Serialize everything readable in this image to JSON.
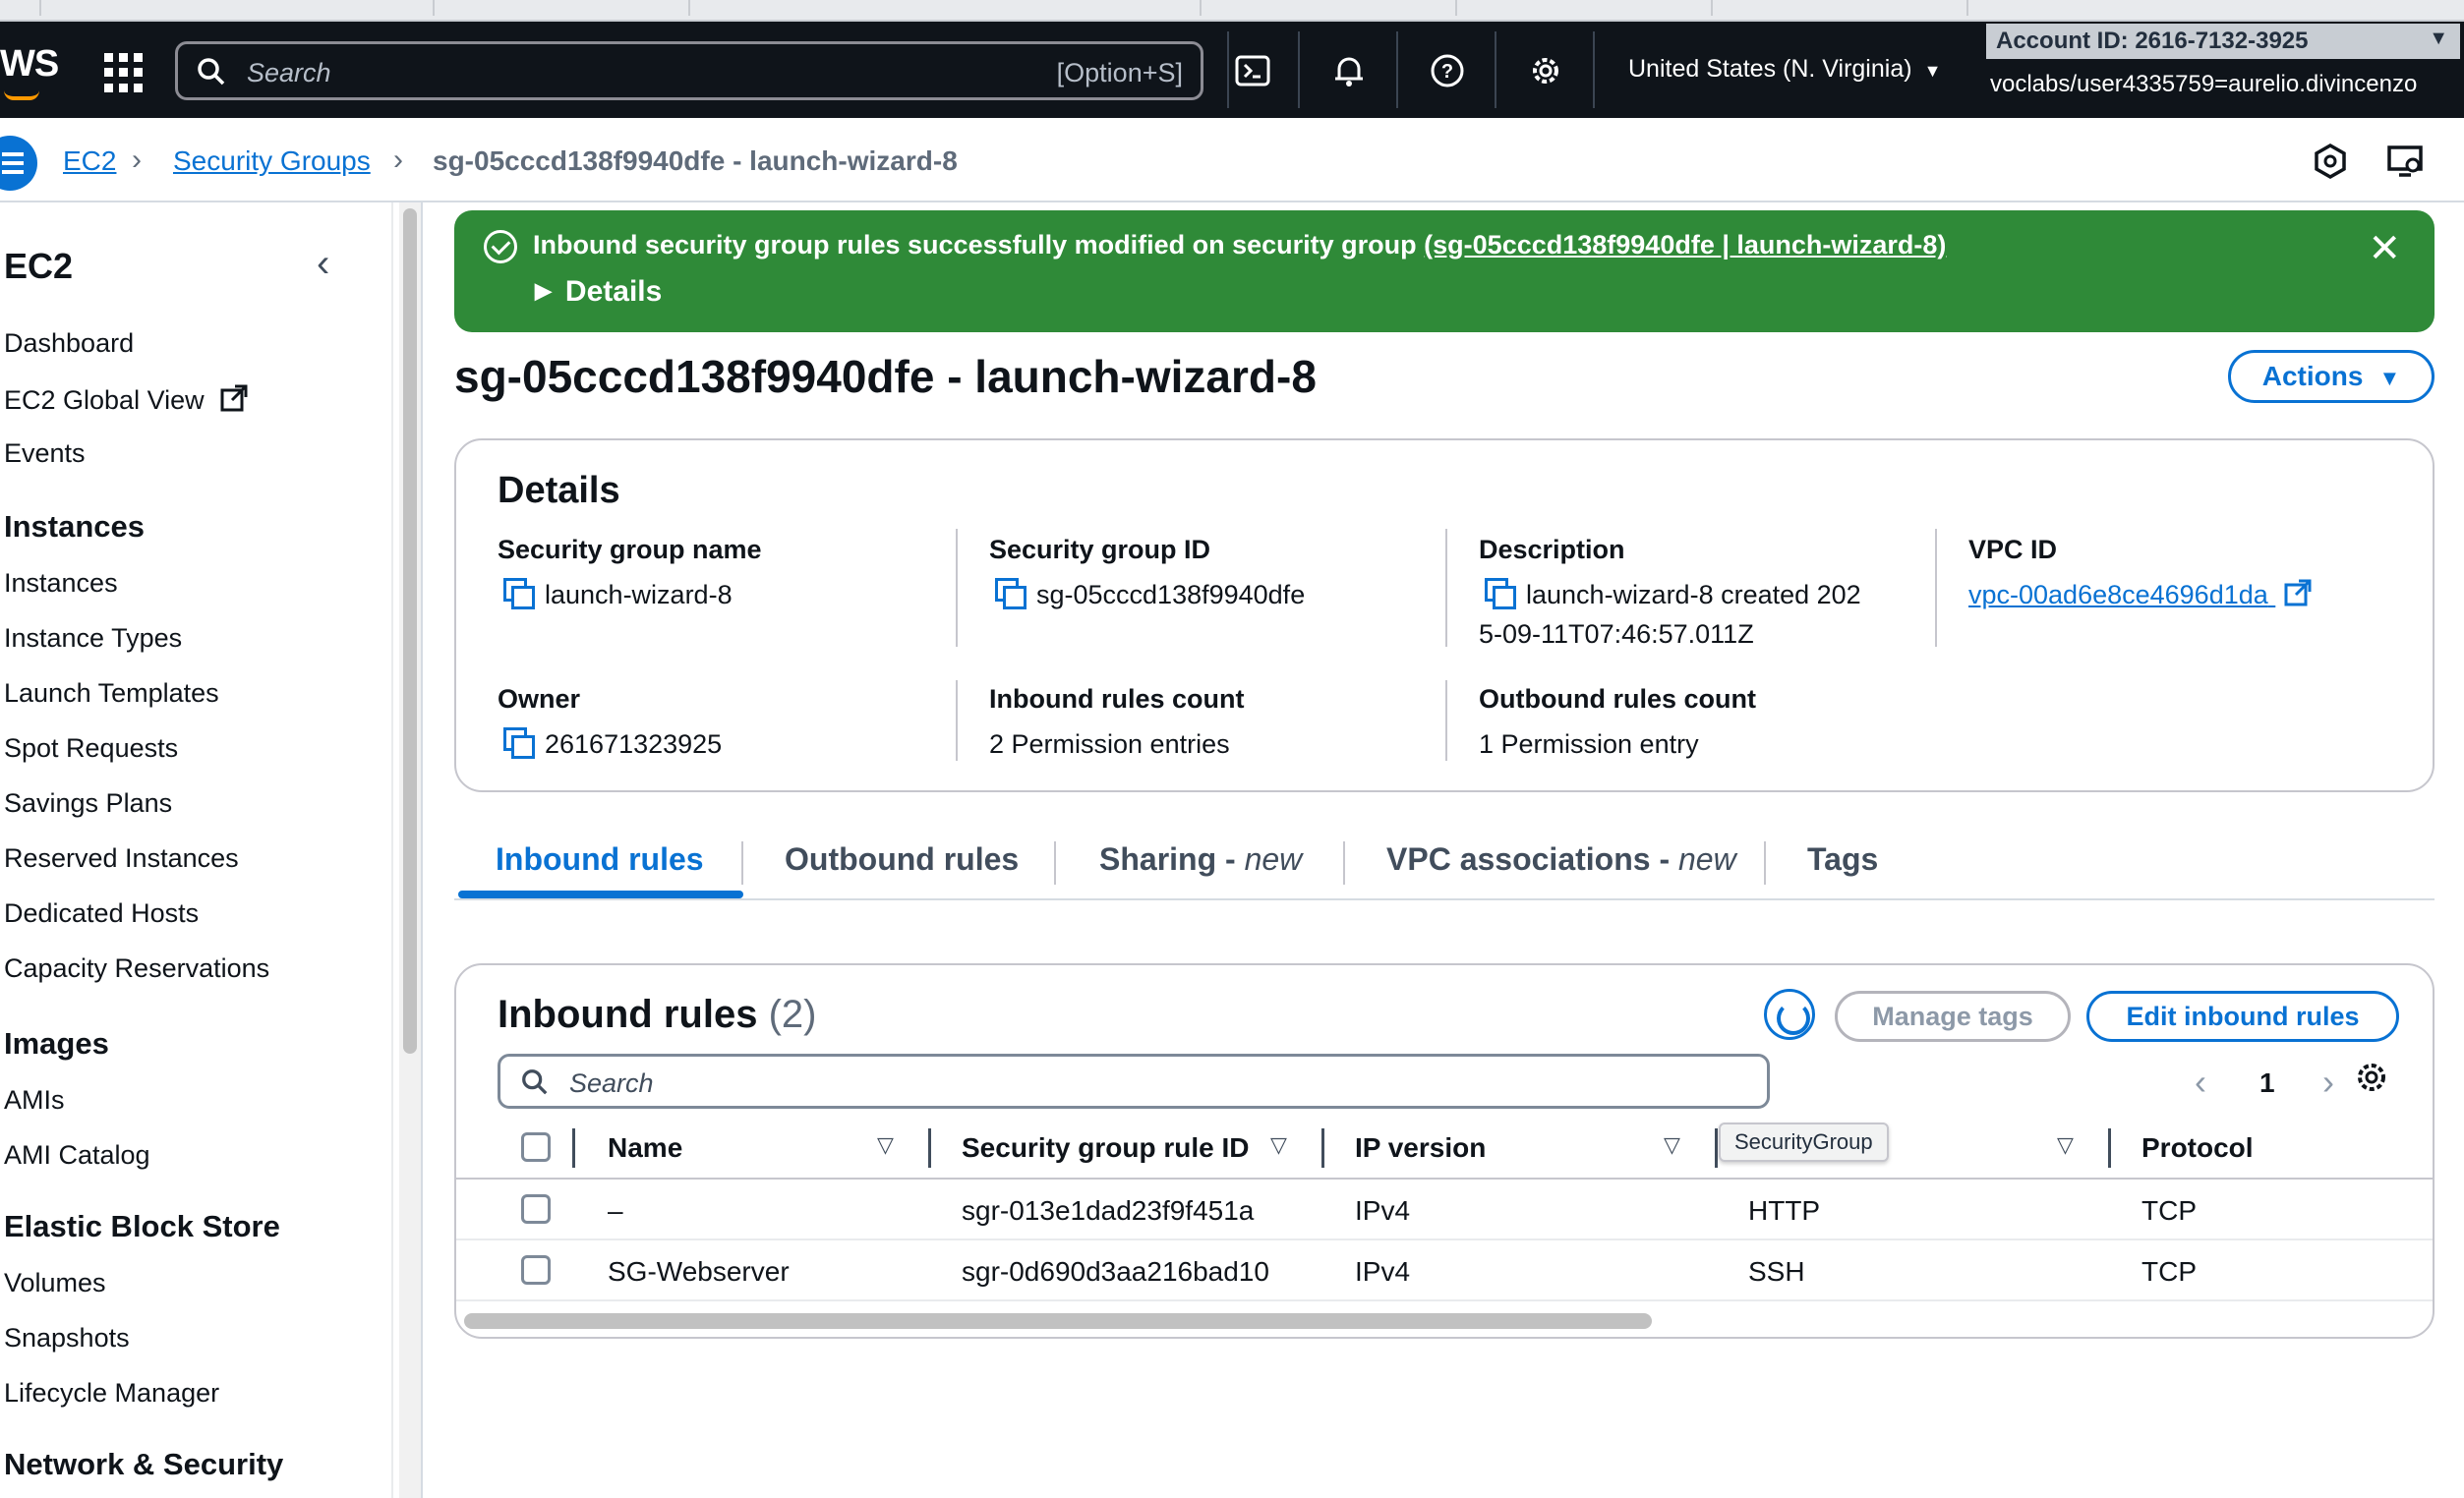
{
  "topnav": {
    "logo": "WS",
    "search_placeholder": "Search",
    "search_shortcut": "[Option+S]",
    "region": "United States (N. Virginia)",
    "account_id": "Account ID: 2616-7132-3925",
    "user": "voclabs/user4335759=aurelio.divincenzo"
  },
  "breadcrumb": {
    "items": [
      "EC2",
      "Security Groups"
    ],
    "current": "sg-05cccd138f9940dfe - launch-wizard-8"
  },
  "sidebar": {
    "title": "EC2",
    "top_items": [
      "Dashboard",
      "EC2 Global View",
      "Events"
    ],
    "sections": [
      {
        "heading": "Instances",
        "items": [
          "Instances",
          "Instance Types",
          "Launch Templates",
          "Spot Requests",
          "Savings Plans",
          "Reserved Instances",
          "Dedicated Hosts",
          "Capacity Reservations"
        ]
      },
      {
        "heading": "Images",
        "items": [
          "AMIs",
          "AMI Catalog"
        ]
      },
      {
        "heading": "Elastic Block Store",
        "items": [
          "Volumes",
          "Snapshots",
          "Lifecycle Manager"
        ]
      },
      {
        "heading": "Network & Security",
        "items": []
      }
    ]
  },
  "flash": {
    "message": "Inbound security group rules successfully modified on security group",
    "link": "(sg-05cccd138f9940dfe | launch-wizard-8)",
    "details": "Details"
  },
  "page": {
    "title": "sg-05cccd138f9940dfe - launch-wizard-8",
    "actions_label": "Actions"
  },
  "details": {
    "heading": "Details",
    "sg_name_label": "Security group name",
    "sg_name": "launch-wizard-8",
    "sg_id_label": "Security group ID",
    "sg_id": "sg-05cccd138f9940dfe",
    "desc_label": "Description",
    "desc_line1": "launch-wizard-8 created 202",
    "desc_line2": "5-09-11T07:46:57.011Z",
    "vpc_label": "VPC ID",
    "vpc_id": "vpc-00ad6e8ce4696d1da",
    "owner_label": "Owner",
    "owner": "261671323925",
    "inbound_count_label": "Inbound rules count",
    "inbound_count": "2 Permission entries",
    "outbound_count_label": "Outbound rules count",
    "outbound_count": "1 Permission entry"
  },
  "tabs": {
    "inbound": "Inbound rules",
    "outbound": "Outbound rules",
    "sharing": "Sharing - ",
    "sharing_new": "new",
    "vpc_assoc": "VPC associations - ",
    "vpc_assoc_new": "new",
    "tags": "Tags"
  },
  "rules": {
    "title": "Inbound rules",
    "count": "(2)",
    "manage_tags": "Manage tags",
    "edit": "Edit inbound rules",
    "search_placeholder": "Search",
    "page": "1",
    "columns": [
      "Name",
      "Security group rule ID",
      "IP version",
      "Type",
      "Protocol"
    ],
    "tooltip": "SecurityGroup",
    "rows": [
      {
        "name": "–",
        "rule_id": "sgr-013e1dad23f9f451a",
        "ip": "IPv4",
        "type": "HTTP",
        "protocol": "TCP"
      },
      {
        "name": "SG-Webserver",
        "rule_id": "sgr-0d690d3aa216bad10",
        "ip": "IPv4",
        "type": "SSH",
        "protocol": "TCP"
      }
    ]
  }
}
